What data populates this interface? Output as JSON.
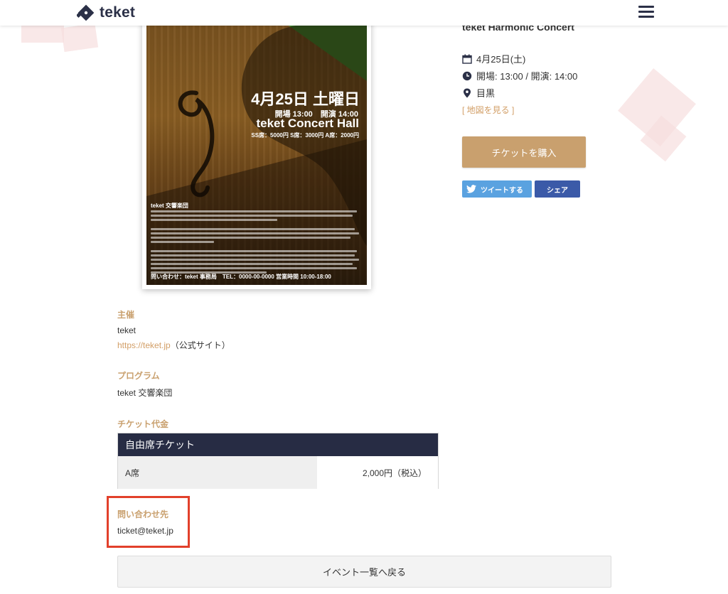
{
  "header": {
    "logo_text": "teket",
    "menu_icon": "hamburger-icon"
  },
  "poster": {
    "date": "4月25日 土曜日",
    "time": "開場 13:00　開演 14:00",
    "hall": "teket Concert Hall",
    "price": "SS席：5000円 S席：3000円 A席：2000円",
    "organizer": "teket 交響楽団",
    "contact": "問い合わせ：teket 事務局　TEL：0000-00-0000 営業時間 10:00-18:00"
  },
  "event": {
    "title": "teket Harmonic Concert",
    "date": "4月25日(土)",
    "time": "開場: 13:00 / 開演: 14:00",
    "venue": "目黒",
    "map_link": "[ 地図を見る ]",
    "buy_label": "チケットを購入",
    "tweet_label": "ツイートする",
    "share_label": "シェア"
  },
  "organizer": {
    "heading": "主催",
    "name": "teket",
    "url": "https://teket.jp",
    "url_note": "（公式サイト）"
  },
  "program": {
    "heading": "プログラム",
    "text": "teket 交響楽団"
  },
  "tickets": {
    "heading": "チケット代金",
    "table_title": "自由席チケット",
    "rows": [
      {
        "seat": "A席",
        "price": "2,000円（税込）"
      }
    ]
  },
  "contact": {
    "heading": "問い合わせ先",
    "email": "ticket@teket.jp"
  },
  "back_label": "イベント一覧へ戻る",
  "colors": {
    "accent": "#c9a06e",
    "navy": "#272c44",
    "twitter": "#5aa2e0",
    "facebook": "#3b5aa8",
    "highlight": "#e2402b"
  }
}
